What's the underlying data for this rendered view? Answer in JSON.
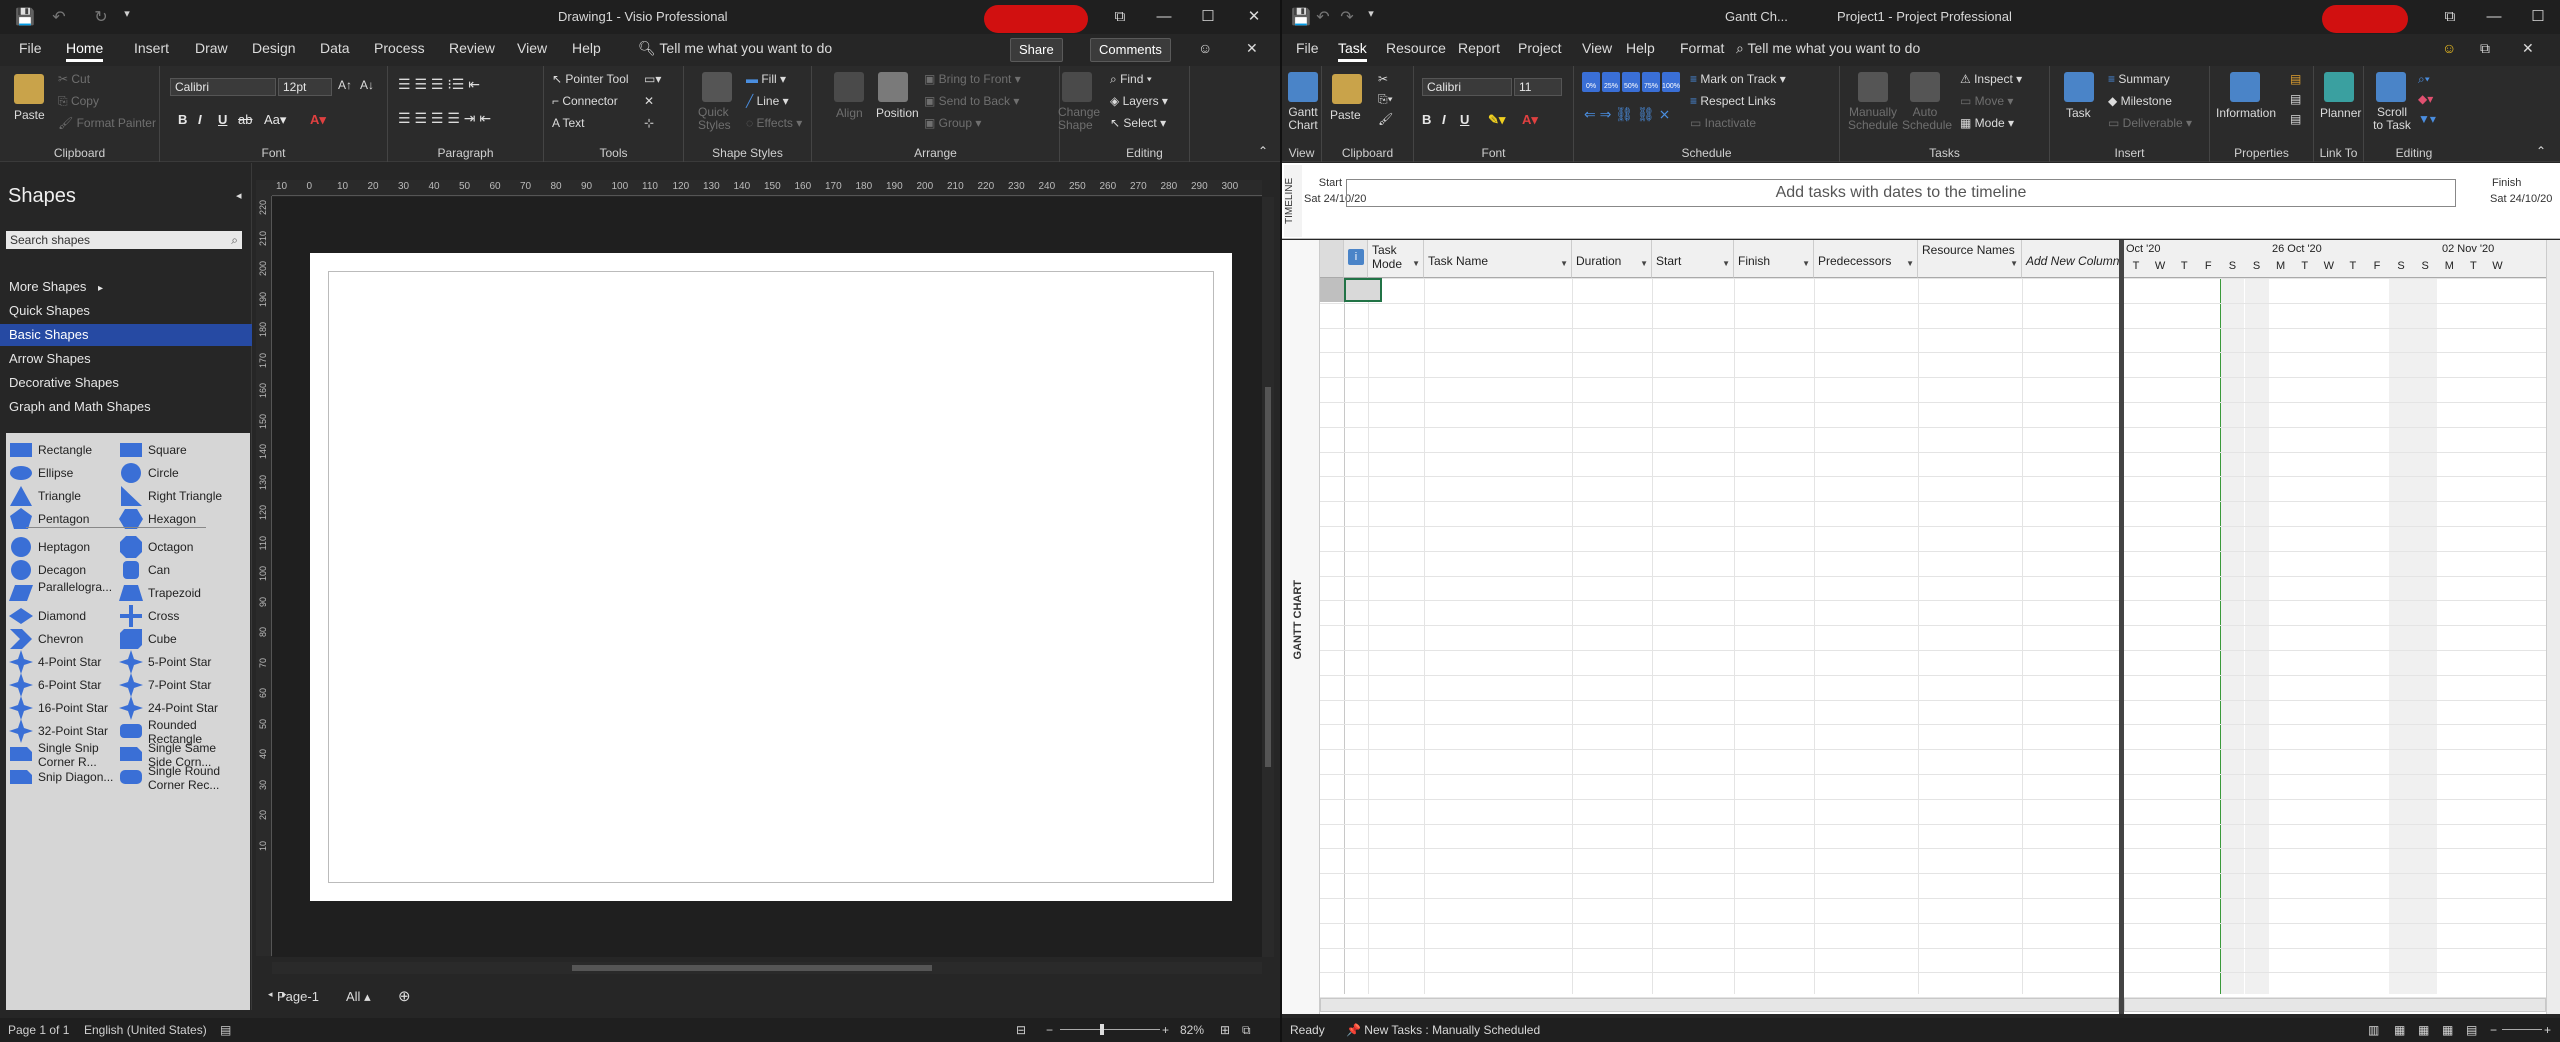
{
  "visio": {
    "title": "Drawing1  -  Visio Professional",
    "tabs": [
      "File",
      "Home",
      "Insert",
      "Draw",
      "Design",
      "Data",
      "Process",
      "Review",
      "View",
      "Help"
    ],
    "active_tab": "Home",
    "tell_me": "Tell me what you want to do",
    "share_label": "Share",
    "comments_label": "Comments",
    "clipboard": {
      "paste": "Paste",
      "cut": "Cut",
      "copy": "Copy",
      "format_painter": "Format Painter",
      "label": "Clipboard"
    },
    "font": {
      "name": "Calibri",
      "size": "12pt",
      "label": "Font"
    },
    "paragraph_label": "Paragraph",
    "tools": {
      "pointer": "Pointer Tool",
      "connector": "Connector",
      "text": "Text",
      "label": "Tools"
    },
    "shape_styles": {
      "quick_styles": "Quick Styles",
      "fill": "Fill",
      "line": "Line",
      "effects": "Effects",
      "label": "Shape Styles"
    },
    "arrange": {
      "align": "Align",
      "position": "Position",
      "bring_front": "Bring to Front",
      "send_back": "Send to Back",
      "group": "Group",
      "change_shape": "Change Shape",
      "label": "Arrange"
    },
    "editing": {
      "find": "Find",
      "layers": "Layers",
      "select": "Select",
      "label": "Editing"
    },
    "shapes_panel": {
      "title": "Shapes",
      "search_placeholder": "Search shapes",
      "nav": [
        "More Shapes",
        "Quick Shapes",
        "Basic Shapes",
        "Arrow Shapes",
        "Decorative Shapes",
        "Graph and Math Shapes"
      ],
      "selected": "Basic Shapes",
      "items": [
        [
          "Rectangle",
          "Square"
        ],
        [
          "Ellipse",
          "Circle"
        ],
        [
          "Triangle",
          "Right Triangle"
        ],
        [
          "Pentagon",
          "Hexagon"
        ],
        [
          "Heptagon",
          "Octagon"
        ],
        [
          "Decagon",
          "Can"
        ],
        [
          "Parallelogra...",
          "Trapezoid"
        ],
        [
          "Diamond",
          "Cross"
        ],
        [
          "Chevron",
          "Cube"
        ],
        [
          "4-Point Star",
          "5-Point Star"
        ],
        [
          "6-Point Star",
          "7-Point Star"
        ],
        [
          "16-Point Star",
          "24-Point Star"
        ],
        [
          "32-Point Star",
          "Rounded Rectangle"
        ],
        [
          "Single Snip Corner R...",
          "Single Same Side Corn..."
        ],
        [
          "Snip Diagon...",
          "Single Round Corner Rec..."
        ]
      ]
    },
    "ruler_h": [
      "10",
      "0",
      "10",
      "20",
      "30",
      "40",
      "50",
      "60",
      "70",
      "80",
      "90",
      "100",
      "110",
      "120",
      "130",
      "140",
      "150",
      "160",
      "170",
      "180",
      "190",
      "200",
      "210",
      "220",
      "230",
      "240",
      "250",
      "260",
      "270",
      "280",
      "290",
      "300"
    ],
    "ruler_v": [
      "220",
      "210",
      "200",
      "190",
      "180",
      "170",
      "160",
      "150",
      "140",
      "130",
      "120",
      "110",
      "100",
      "90",
      "80",
      "70",
      "60",
      "50",
      "40",
      "30",
      "20",
      "10"
    ],
    "page_tab": "Page-1",
    "all_tab": "All",
    "status": {
      "page": "Page 1 of 1",
      "language": "English (United States)",
      "zoom": "82%"
    },
    "accent": "#264aa3"
  },
  "project": {
    "title_left": "Gantt Ch...",
    "title": "Project1  -  Project Professional",
    "tabs": [
      "File",
      "Task",
      "Resource",
      "Report",
      "Project",
      "View",
      "Help",
      "Format"
    ],
    "active_tab": "Task",
    "tell_me": "Tell me what you want to do",
    "view": {
      "gantt": "Gantt Chart",
      "label": "View"
    },
    "clipboard": {
      "paste": "Paste",
      "label": "Clipboard"
    },
    "font": {
      "name": "Calibri",
      "size": "11",
      "label": "Font"
    },
    "schedule": {
      "mark": "Mark on Track",
      "respect": "Respect Links",
      "inactivate": "Inactivate",
      "label": "Schedule",
      "pcts": [
        "0%",
        "25%",
        "50%",
        "75%",
        "100%"
      ]
    },
    "tasks": {
      "manual": "Manually Schedule",
      "auto": "Auto Schedule",
      "inspect": "Inspect",
      "move": "Move",
      "mode": "Mode",
      "label": "Tasks"
    },
    "insert": {
      "task": "Task",
      "summary": "Summary",
      "milestone": "Milestone",
      "deliverable": "Deliverable",
      "label": "Insert"
    },
    "properties": {
      "information": "Information",
      "label": "Properties"
    },
    "link_to": {
      "planner": "Planner",
      "label": "Link To"
    },
    "editing": {
      "scroll": "Scroll to Task",
      "label": "Editing"
    },
    "timeline": {
      "label": "TIMELINE",
      "start": "Start",
      "start_date": "Sat 24/10/20",
      "placeholder": "Add tasks with dates to the timeline",
      "finish": "Finish",
      "finish_date": "Sat 24/10/20"
    },
    "gantt_label": "GANTT CHART",
    "columns": [
      "Task Mode",
      "Task Name",
      "Duration",
      "Start",
      "Finish",
      "Predecessors",
      "Resource Names",
      "Add New Column"
    ],
    "weeks": [
      "Oct '20",
      "26 Oct '20",
      "02 Nov '20"
    ],
    "days": [
      "T",
      "W",
      "T",
      "F",
      "S",
      "S",
      "M",
      "T",
      "W",
      "T",
      "F",
      "S",
      "S",
      "M",
      "T",
      "W"
    ],
    "status": {
      "ready": "Ready",
      "new_tasks": "New Tasks : Manually Scheduled"
    }
  }
}
